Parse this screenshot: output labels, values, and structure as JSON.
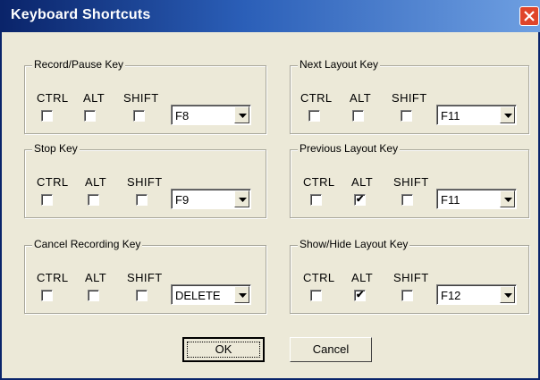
{
  "dialog": {
    "title": "Keyboard Shortcuts",
    "modifier_labels": {
      "ctrl": "CTRL",
      "alt": "ALT",
      "shift": "SHIFT"
    },
    "groups": [
      {
        "label": "Record/Pause Key",
        "ctrl": false,
        "alt": false,
        "shift": false,
        "key": "F8"
      },
      {
        "label": "Next Layout Key",
        "ctrl": false,
        "alt": false,
        "shift": false,
        "key": "F11"
      },
      {
        "label": "Stop Key",
        "ctrl": false,
        "alt": false,
        "shift": false,
        "key": "F9"
      },
      {
        "label": "Previous Layout Key",
        "ctrl": false,
        "alt": true,
        "shift": false,
        "key": "F11"
      },
      {
        "label": "Cancel Recording Key",
        "ctrl": false,
        "alt": false,
        "shift": false,
        "key": "DELETE"
      },
      {
        "label": "Show/Hide Layout Key",
        "ctrl": false,
        "alt": true,
        "shift": false,
        "key": "F12"
      }
    ],
    "buttons": {
      "ok": "OK",
      "cancel": "Cancel"
    },
    "colors": {
      "title_bar": "#0a246a",
      "close_button": "#e0452a",
      "face": "#ece9d8"
    }
  }
}
